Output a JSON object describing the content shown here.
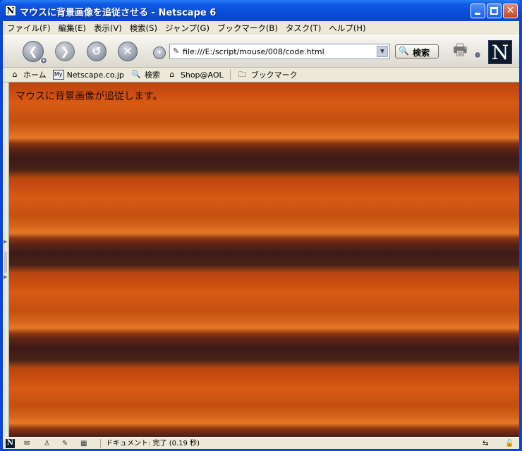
{
  "window": {
    "title": "マウスに背景画像を追従させる - Netscape 6",
    "app_icon_glyph": "N"
  },
  "menu": [
    "ファイル(F)",
    "編集(E)",
    "表示(V)",
    "検索(S)",
    "ジャンプ(G)",
    "ブックマーク(B)",
    "タスク(T)",
    "ヘルプ(H)"
  ],
  "navigation": {
    "url": "file:///E:/script/mouse/008/code.html",
    "search_label": "検索",
    "logo_glyph": "N"
  },
  "personal_toolbar": [
    {
      "label": "ホーム",
      "icon": "home-icon"
    },
    {
      "label": "Netscape.co.jp",
      "icon": "my-netscape-icon"
    },
    {
      "label": "検索",
      "icon": "search-icon"
    },
    {
      "label": "Shop@AOL",
      "icon": "shop-icon"
    },
    {
      "label": "ブックマーク",
      "icon": "folder-icon"
    }
  ],
  "content": {
    "text": "マウスに背景画像が追従します。"
  },
  "status": {
    "text": "ドキュメント: 完了 (0.19 秒)",
    "netscape_glyph": "N"
  }
}
